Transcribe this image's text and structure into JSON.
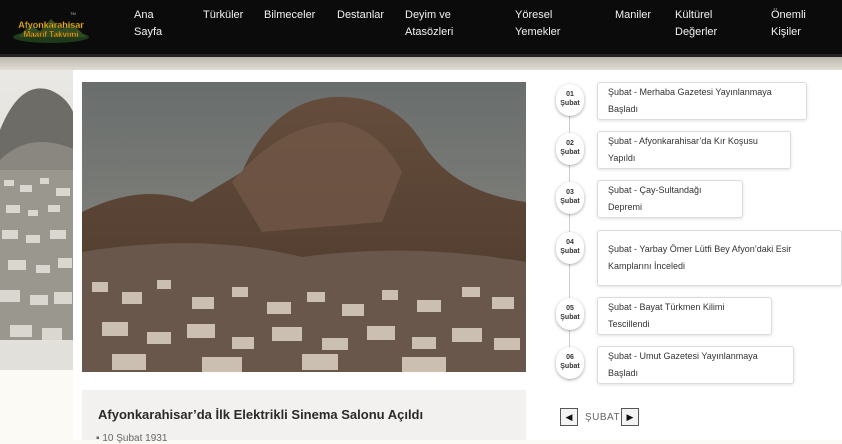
{
  "brand": {
    "logo_text_line1": "Afyonkarahisar",
    "logo_text_line2": "Maarif Takvimi",
    "logo_tm": "TM"
  },
  "nav": [
    {
      "label": "Ana\nSayfa"
    },
    {
      "label": "Türküler"
    },
    {
      "label": "Bilmeceler"
    },
    {
      "label": "Destanlar"
    },
    {
      "label": "Deyim ve\nAtasözleri"
    },
    {
      "label": "Yöresel\nYemekler"
    },
    {
      "label": "Maniler"
    },
    {
      "label": "Kültürel\nDeğerler"
    },
    {
      "label": "Önemli\nKişiler"
    }
  ],
  "featured": {
    "title": "Afyonkarahisar’da İlk Elektrikli Sinema Salonu Açıldı",
    "date": "10 Şubat 1931"
  },
  "timeline": [
    {
      "day": "01",
      "month": "Şubat",
      "text": "Şubat - Merhaba Gazetesi Yayınlanmaya Başladı"
    },
    {
      "day": "02",
      "month": "Şubat",
      "text": "Şubat - Afyonkarahisar’da Kır Koşusu Yapıldı"
    },
    {
      "day": "03",
      "month": "Şubat",
      "text": "Şubat - Çay-Sultandağı Depremi"
    },
    {
      "day": "04",
      "month": "Şubat",
      "text": "Şubat - Yarbay Ömer Lütfi Bey Afyon’daki Esir Kamplarını İnceledi"
    },
    {
      "day": "05",
      "month": "Şubat",
      "text": "Şubat - Bayat Türkmen Kilimi Tescillendi"
    },
    {
      "day": "06",
      "month": "Şubat",
      "text": "Şubat - Umut Gazetesi Yayınlanmaya Başladı"
    }
  ],
  "pager": {
    "prev": "◀",
    "label": "ŞUBAT",
    "next": "▶"
  },
  "icons": {
    "prev": "caret-left-icon",
    "next": "caret-right-icon",
    "date": "calendar-icon"
  }
}
